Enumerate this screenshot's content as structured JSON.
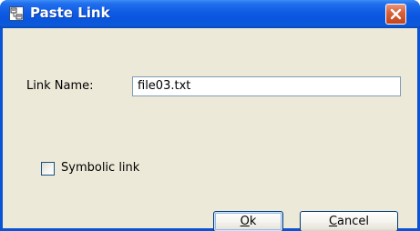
{
  "window": {
    "title": "Paste Link",
    "title_icon": "link-app-icon",
    "close_icon": "close-icon",
    "colors": {
      "titlebar": "#0a55de",
      "client": "#ece9d8",
      "close_button": "#d9623c"
    }
  },
  "form": {
    "link_name_label": "Link Name:",
    "link_name_value": "file03.txt",
    "symbolic_link_label": "Symbolic link",
    "symbolic_link_checked": false
  },
  "buttons": {
    "ok": {
      "mnemonic": "O",
      "rest": "k"
    },
    "cancel": {
      "mnemonic": "C",
      "rest": "ancel"
    }
  }
}
